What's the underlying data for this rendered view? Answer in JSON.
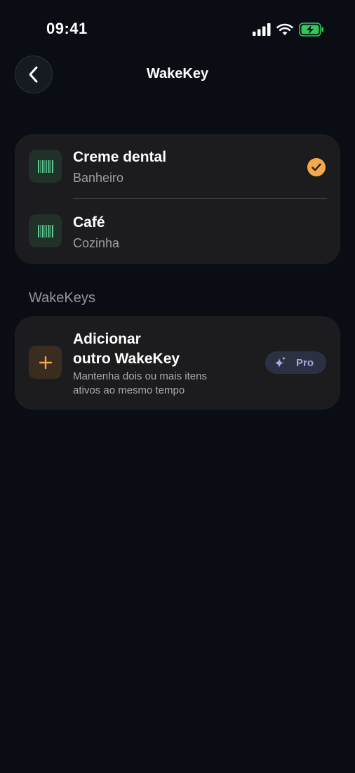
{
  "status_bar": {
    "time": "09:41"
  },
  "header": {
    "title": "WakeKey"
  },
  "items": [
    {
      "name": "Creme dental",
      "location": "Banheiro",
      "selected": true
    },
    {
      "name": "Café",
      "location": "Cozinha",
      "selected": false
    }
  ],
  "section": {
    "title": "WakeKeys"
  },
  "add_item": {
    "title_line1": "Adicionar",
    "title_line2": "outro WakeKey",
    "subtitle_line1": "Mantenha dois ou mais itens",
    "subtitle_line2": "ativos ao mesmo tempo",
    "badge_label": "Pro"
  },
  "colors": {
    "background": "#0a0d14",
    "card": "#1c1c1e",
    "accent_orange": "#f5a94a",
    "barcode_green": "#5fc792",
    "battery_green": "#34c759",
    "pro_text": "#a2acdb"
  },
  "icons": {
    "back": "chevron-left-icon",
    "item": "barcode-icon",
    "selected": "checkmark-icon",
    "add": "plus-icon",
    "pro": "sparkles-icon"
  }
}
